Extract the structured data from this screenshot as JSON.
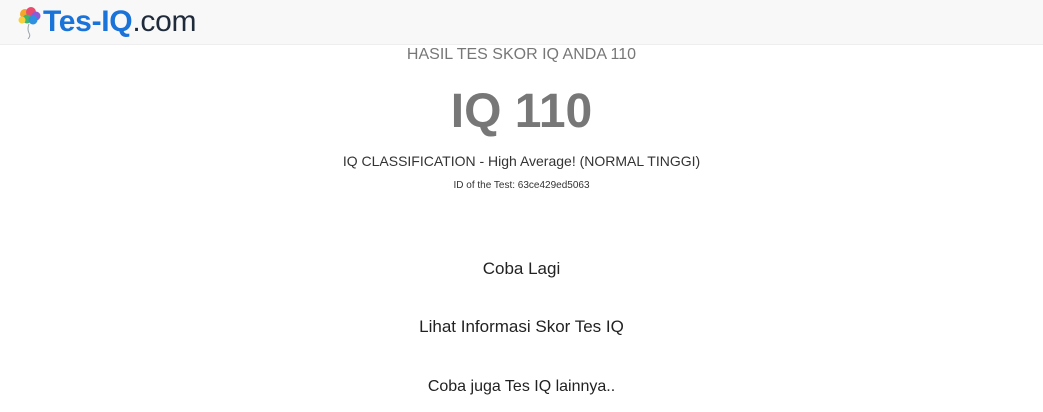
{
  "header": {
    "logo_brand": "Tes-IQ",
    "logo_tld": ".com",
    "logo_icon": "brain-icon"
  },
  "result": {
    "heading": "HASIL TES SKOR IQ ANDA 110",
    "score": "IQ 110",
    "classification": "IQ CLASSIFICATION - High Average! (NORMAL TINGGI)",
    "test_id": "ID of the Test: 63ce429ed5063"
  },
  "links": {
    "retry": "Coba Lagi",
    "info": "Lihat Informasi Skor Tes IQ",
    "other": "Coba juga Tes IQ lainnya.."
  },
  "colors": {
    "brand_blue": "#1a73d9",
    "header_bg": "#f8f8f8",
    "muted_text": "#777777"
  }
}
